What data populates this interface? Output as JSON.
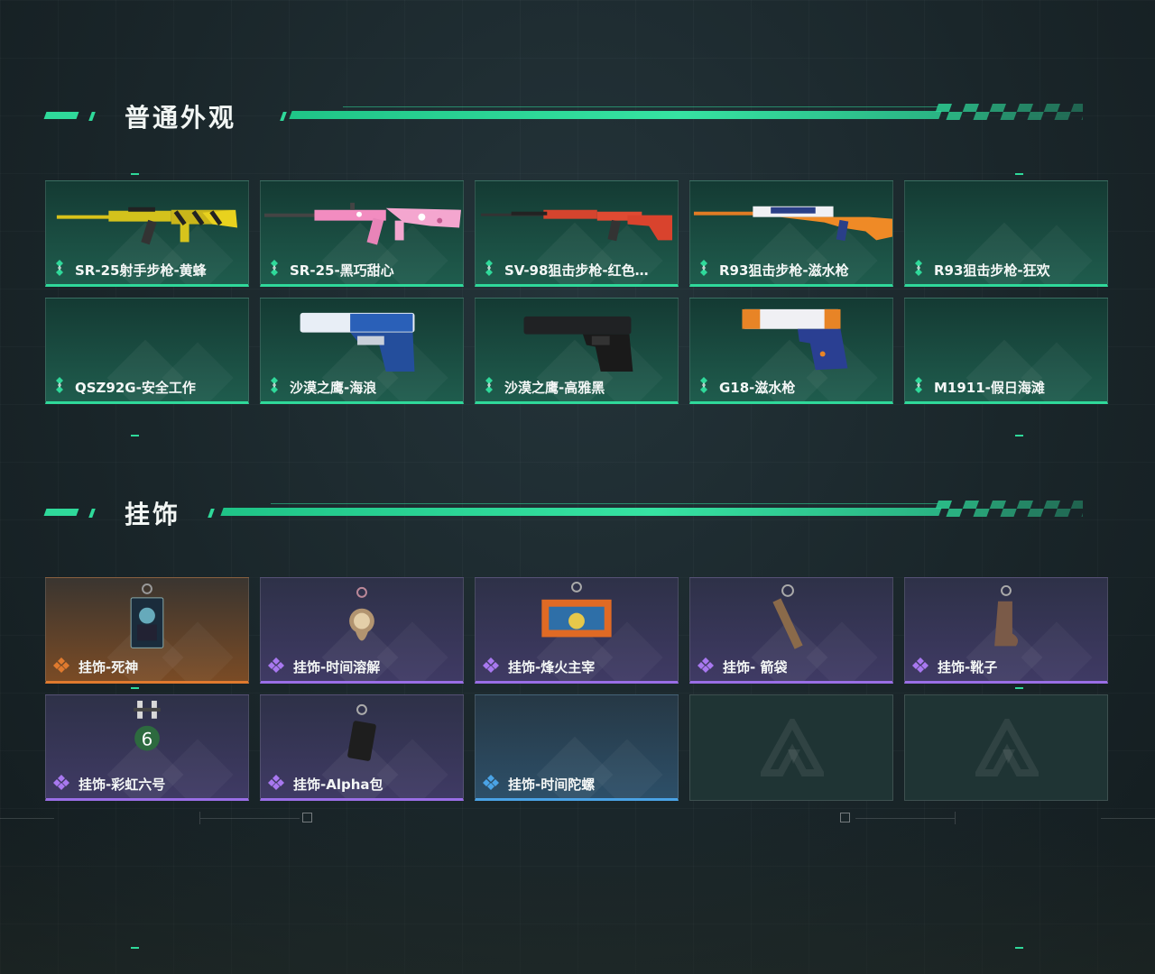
{
  "sections": [
    {
      "title": "普通外观",
      "items": [
        {
          "label": "SR-25射手步枪-黄蜂",
          "quality": "green",
          "art": "rifle-yellow"
        },
        {
          "label": "SR-25-黑巧甜心",
          "quality": "green",
          "art": "rifle-pink"
        },
        {
          "label": "SV-98狙击步枪-红色…",
          "quality": "green",
          "art": "sniper-red"
        },
        {
          "label": "R93狙击步枪-滋水枪",
          "quality": "green",
          "art": "sniper-orange"
        },
        {
          "label": "R93狙击步枪-狂欢",
          "quality": "green",
          "art": "none"
        },
        {
          "label": "QSZ92G-安全工作",
          "quality": "green",
          "art": "none"
        },
        {
          "label": "沙漠之鹰-海浪",
          "quality": "green",
          "art": "pistol-blue"
        },
        {
          "label": "沙漠之鹰-高雅黑",
          "quality": "green",
          "art": "pistol-black"
        },
        {
          "label": "G18-滋水枪",
          "quality": "green",
          "art": "pistol-orange"
        },
        {
          "label": "M1911-假日海滩",
          "quality": "green",
          "art": "none"
        }
      ]
    },
    {
      "title": "挂饰",
      "items": [
        {
          "label": "挂饰-死神",
          "quality": "orange",
          "art": "charm-card"
        },
        {
          "label": "挂饰-时间溶解",
          "quality": "purple",
          "art": "charm-clock"
        },
        {
          "label": "挂饰-烽火主宰",
          "quality": "purple",
          "art": "charm-crate"
        },
        {
          "label": "挂饰- 箭袋",
          "quality": "purple",
          "art": "charm-quiver"
        },
        {
          "label": "挂饰-靴子",
          "quality": "purple",
          "art": "charm-boot"
        },
        {
          "label": "挂饰-彩虹六号",
          "quality": "purple",
          "art": "charm-six"
        },
        {
          "label": "挂饰-Alpha包",
          "quality": "purple",
          "art": "charm-bag"
        },
        {
          "label": "挂饰-时间陀螺",
          "quality": "blue",
          "art": "none"
        },
        {
          "label": "",
          "quality": "empty",
          "art": "none"
        },
        {
          "label": "",
          "quality": "empty",
          "art": "none"
        }
      ]
    }
  ],
  "colors": {
    "accent": "#2fd99a",
    "green_quality": "#2fd99a",
    "purple_quality": "#9a6ee6",
    "orange_quality": "#e07a2e",
    "blue_quality": "#4aa3e6"
  }
}
